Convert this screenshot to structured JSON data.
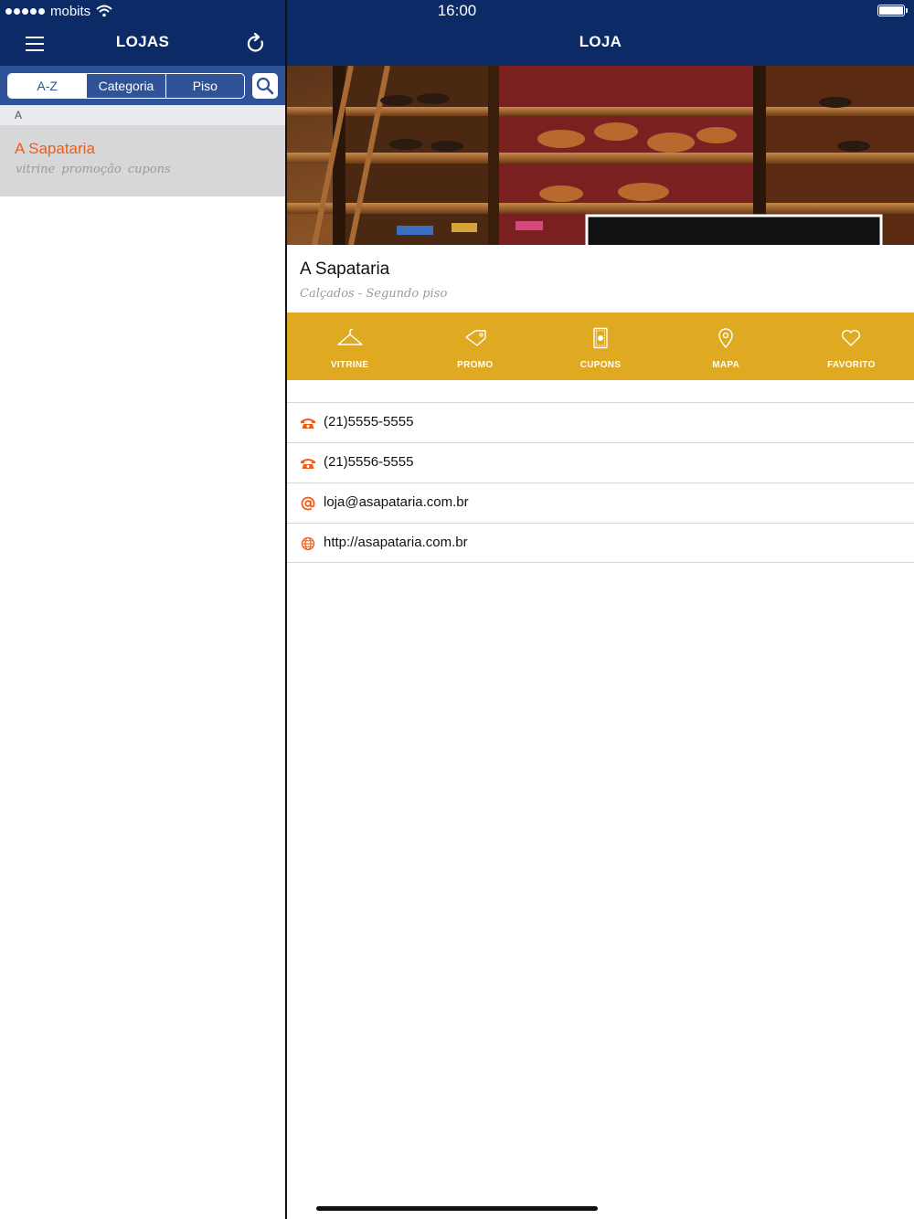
{
  "status": {
    "carrier": "mobits",
    "time": "16:00"
  },
  "left_nav": {
    "title": "LOJAS"
  },
  "right_nav": {
    "title": "LOJA"
  },
  "filters": {
    "tabs": [
      "A-Z",
      "Categoria",
      "Piso"
    ],
    "selected": "A-Z"
  },
  "list": {
    "section": "A",
    "items": [
      {
        "name": "A Sapataria",
        "tags": "vitrine promoção cupons"
      }
    ]
  },
  "detail": {
    "name": "A Sapataria",
    "subtitle": "Calçados - Segundo piso",
    "actions": [
      "VITRINE",
      "PROMO",
      "CUPONS",
      "MAPA",
      "FAVORITO"
    ],
    "contacts": [
      {
        "icon": "phone-icon",
        "text": "(21)5555-5555"
      },
      {
        "icon": "phone-icon",
        "text": "(21)5556-5555"
      },
      {
        "icon": "at-icon",
        "text": "loja@asapataria.com.br"
      },
      {
        "icon": "globe-icon",
        "text": "http://asapataria.com.br"
      }
    ]
  },
  "colors": {
    "nav_bg": "#0b2a66",
    "filter_bg": "#2f5396",
    "accent_orange": "#ef5b18",
    "action_bar": "#dfa921",
    "selected_row": "#d7d7d9"
  }
}
